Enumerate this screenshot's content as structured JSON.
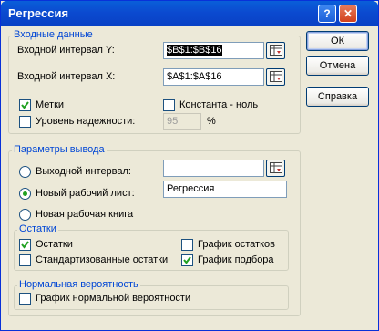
{
  "window": {
    "title": "Регрессия"
  },
  "input_group": {
    "legend": "Входные данные",
    "input_y": {
      "label": "Входной интервал Y:",
      "value": "$B$1:$B$16"
    },
    "input_x": {
      "label": "Входной интервал X:",
      "value": "$A$1:$A$16"
    },
    "labels_cb": {
      "label": "Метки",
      "checked": true
    },
    "const_zero_cb": {
      "label": "Константа - ноль",
      "checked": false
    },
    "confidence_cb": {
      "label": "Уровень надежности:",
      "checked": false
    },
    "confidence_value": "95",
    "percent": "%"
  },
  "output_group": {
    "legend": "Параметры вывода",
    "output_range": {
      "label": "Выходной интервал:",
      "selected": false,
      "value": ""
    },
    "new_sheet": {
      "label": "Новый рабочий лист:",
      "selected": true,
      "value": "Регрессия"
    },
    "new_book": {
      "label": "Новая рабочая книга",
      "selected": false
    }
  },
  "residuals_group": {
    "legend": "Остатки",
    "residuals": {
      "label": "Остатки",
      "checked": true
    },
    "std_residuals": {
      "label": "Стандартизованные остатки",
      "checked": false
    },
    "residual_plot": {
      "label": "График остатков",
      "checked": false
    },
    "fit_plot": {
      "label": "График подбора",
      "checked": true
    }
  },
  "normal_group": {
    "legend": "Нормальная вероятность",
    "normal_plot": {
      "label": "График нормальной вероятности",
      "checked": false
    }
  },
  "buttons": {
    "ok": "ОК",
    "cancel": "Отмена",
    "help": "Справка"
  },
  "titlebar_buttons": {
    "help": "?",
    "close": "✕"
  }
}
